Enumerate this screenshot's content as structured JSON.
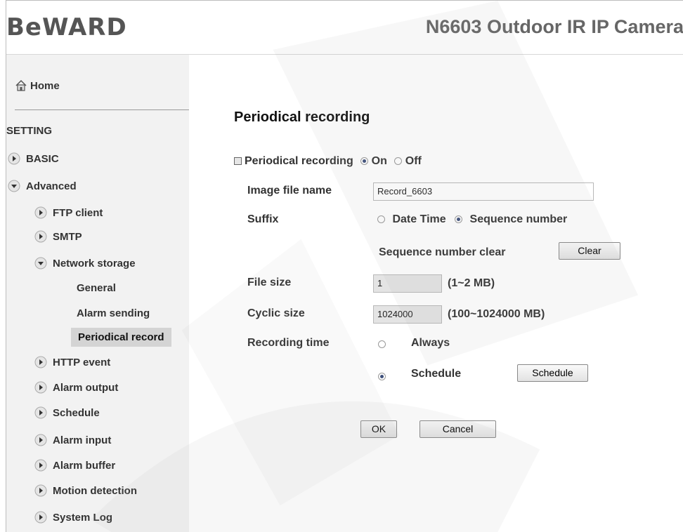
{
  "header": {
    "logo": "BeWARD",
    "model": "N6603 Outdoor IR IP Camera"
  },
  "sidebar": {
    "home": "Home",
    "section": "SETTING",
    "items": [
      {
        "label": "BASIC"
      },
      {
        "label": "Advanced"
      },
      {
        "label": "FTP client"
      },
      {
        "label": "SMTP"
      },
      {
        "label": "Network storage"
      },
      {
        "label": "General"
      },
      {
        "label": "Alarm sending"
      },
      {
        "label": "Periodical record"
      },
      {
        "label": "HTTP event"
      },
      {
        "label": "Alarm output"
      },
      {
        "label": "Schedule"
      },
      {
        "label": "Alarm input"
      },
      {
        "label": "Alarm buffer"
      },
      {
        "label": "Motion detection"
      },
      {
        "label": "System Log"
      }
    ]
  },
  "form": {
    "title": "Periodical recording",
    "enable_label": "Periodical recording",
    "on_label": "On",
    "off_label": "Off",
    "image_file_name_label": "Image file name",
    "image_file_name_value": "Record_6603",
    "suffix_label": "Suffix",
    "date_time_label": "Date Time",
    "sequence_number_label": "Sequence number",
    "sequence_clear_label": "Sequence number clear",
    "clear_button": "Clear",
    "file_size_label": "File size",
    "file_size_value": "1",
    "file_size_range": "(1~2 MB)",
    "cyclic_size_label": "Cyclic size",
    "cyclic_size_value": "1024000",
    "cyclic_size_range": "(100~1024000 MB)",
    "recording_time_label": "Recording time",
    "always_label": "Always",
    "schedule_label": "Schedule",
    "schedule_button": "Schedule",
    "ok_button": "OK",
    "cancel_button": "Cancel"
  }
}
